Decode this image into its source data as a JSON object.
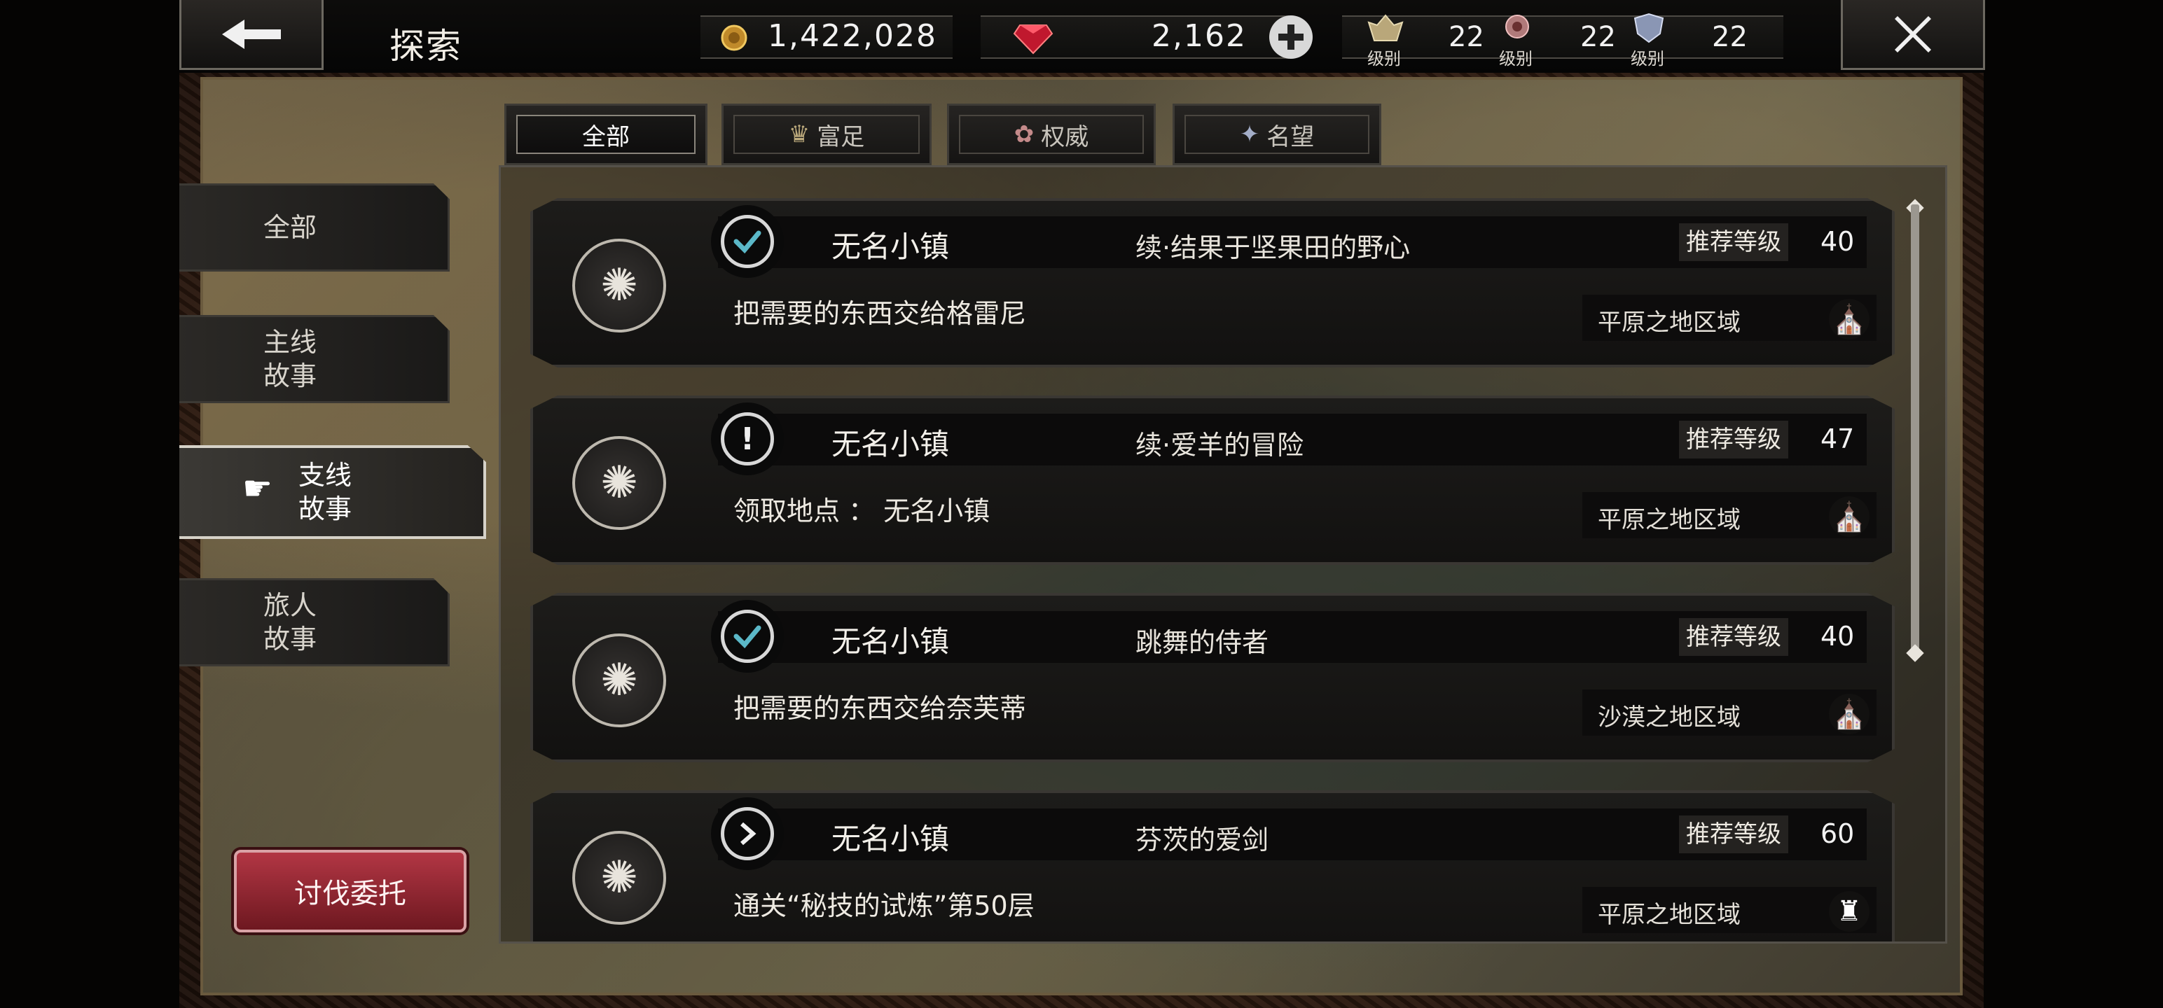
{
  "header": {
    "title": "探索",
    "gold": "1,422,028",
    "gems": "2,162",
    "ranks": [
      {
        "label": "级别",
        "value": "22",
        "icon": "wealth-rank-icon"
      },
      {
        "label": "级别",
        "value": "22",
        "icon": "power-rank-icon"
      },
      {
        "label": "级别",
        "value": "22",
        "icon": "fame-rank-icon"
      }
    ]
  },
  "filters": [
    {
      "label": "全部",
      "active": true
    },
    {
      "label": "富足",
      "active": false
    },
    {
      "label": "权威",
      "active": false
    },
    {
      "label": "名望",
      "active": false
    }
  ],
  "sidebar": {
    "items": [
      {
        "label": "全部"
      },
      {
        "label": "主线\n故事"
      },
      {
        "label": "支线\n故事"
      },
      {
        "label": "旅人\n故事"
      }
    ],
    "action_button": "讨伐委托"
  },
  "quests": [
    {
      "status": "complete",
      "location": "无名小镇",
      "name": "续·结果于坚果田的野心",
      "rec_label": "推荐等级",
      "rec_level": "40",
      "desc": "把需要的东西交给格雷尼",
      "region": "平原之地区域",
      "region_icon": "town-icon"
    },
    {
      "status": "new",
      "location": "无名小镇",
      "name": "续·爱羊的冒险",
      "rec_label": "推荐等级",
      "rec_level": "47",
      "desc": "领取地点 ： 无名小镇",
      "region": "平原之地区域",
      "region_icon": "town-icon"
    },
    {
      "status": "complete",
      "location": "无名小镇",
      "name": "跳舞的侍者",
      "rec_label": "推荐等级",
      "rec_level": "40",
      "desc": "把需要的东西交给奈芙蒂",
      "region": "沙漠之地区域",
      "region_icon": "town-icon"
    },
    {
      "status": "in-progress",
      "location": "无名小镇",
      "name": "芬茨的爱剑",
      "rec_label": "推荐等级",
      "rec_level": "60",
      "desc": "通关“秘技的试炼”第50层",
      "region": "平原之地区域",
      "region_icon": "tower-icon"
    }
  ],
  "colors": {
    "accent_red": "#b23644",
    "panel_border": "#55514a"
  }
}
